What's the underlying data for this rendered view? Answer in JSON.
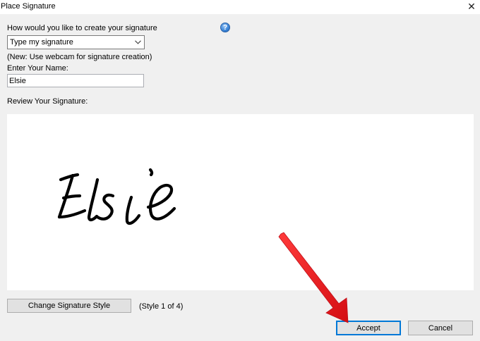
{
  "window": {
    "title": "Place Signature",
    "close_glyph": "✕"
  },
  "form": {
    "create_prompt": "How would you like to create your signature",
    "help_glyph": "?",
    "method_select": {
      "selected": "Type my signature"
    },
    "webcam_note": "(New: Use webcam for signature creation)",
    "name_label": "Enter Your Name:",
    "name_value": "Elsie",
    "review_label": "Review Your Signature:"
  },
  "signature": {
    "text": "Elsie"
  },
  "style": {
    "change_button": "Change Signature Style",
    "style_status": "(Style 1 of 4)"
  },
  "actions": {
    "accept": "Accept",
    "cancel": "Cancel"
  },
  "icons": {
    "close": "close-icon",
    "help": "help-icon",
    "dropdown": "chevron-down-icon",
    "annotation": "red-arrow-icon"
  },
  "colors": {
    "dialog_bg": "#f0f0f0",
    "accent": "#0078d7",
    "arrow": "#ee1b24"
  }
}
